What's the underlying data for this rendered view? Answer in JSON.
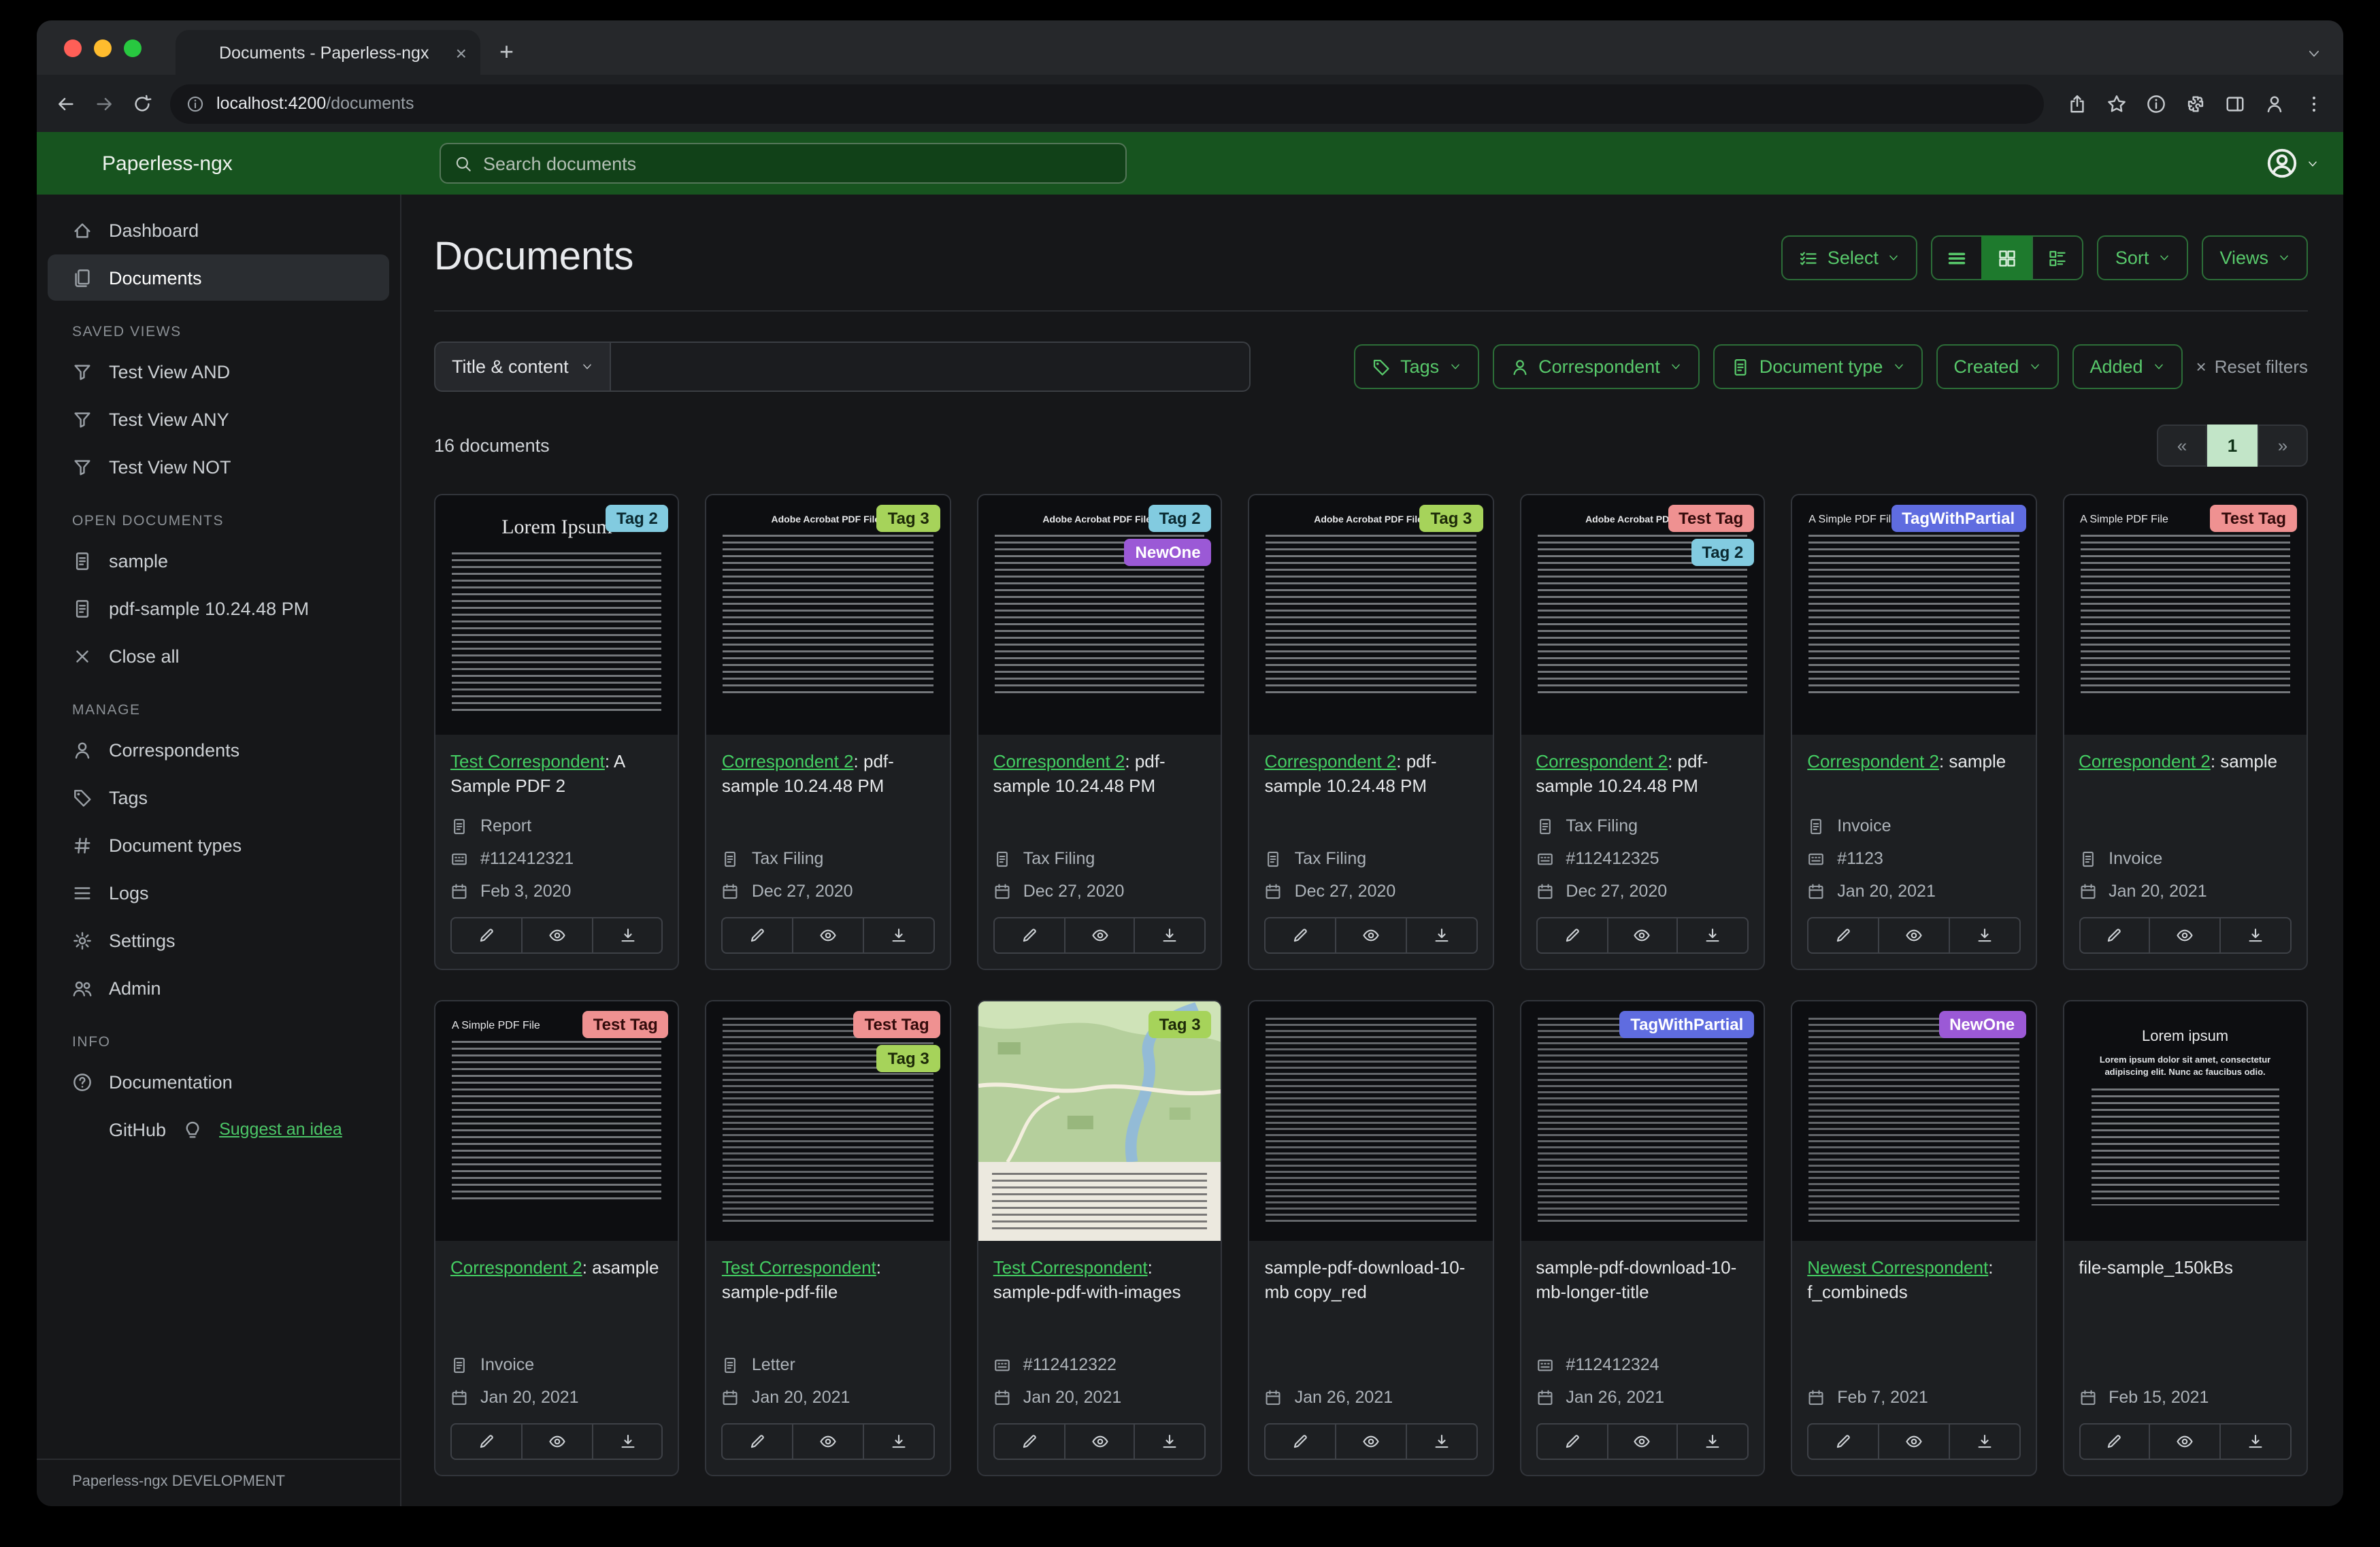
{
  "browser": {
    "tab_title": "Documents - Paperless-ngx",
    "url_host": "localhost:4200",
    "url_path": "/documents",
    "new_tab": "+",
    "tab_close": "×"
  },
  "header": {
    "brand": "Paperless-ngx",
    "search_placeholder": "Search documents"
  },
  "sidebar": {
    "primary": [
      {
        "label": "Dashboard",
        "icon": "house",
        "active": false
      },
      {
        "label": "Documents",
        "icon": "files",
        "active": true
      }
    ],
    "saved_views": {
      "heading": "SAVED VIEWS",
      "icon": "funnel",
      "items": [
        "Test View AND",
        "Test View ANY",
        "Test View NOT"
      ]
    },
    "open_documents": {
      "heading": "OPEN DOCUMENTS",
      "icon": "file",
      "items": [
        "sample",
        "pdf-sample 10.24.48 PM"
      ],
      "close_all": "Close all"
    },
    "manage": {
      "heading": "MANAGE",
      "items": [
        {
          "label": "Correspondents",
          "icon": "person"
        },
        {
          "label": "Tags",
          "icon": "tag"
        },
        {
          "label": "Document types",
          "icon": "hash"
        },
        {
          "label": "Logs",
          "icon": "listlines"
        },
        {
          "label": "Settings",
          "icon": "gear"
        },
        {
          "label": "Admin",
          "icon": "people"
        }
      ]
    },
    "info": {
      "heading": "INFO",
      "items": [
        {
          "label": "Documentation",
          "icon": "question"
        },
        {
          "label": "GitHub",
          "icon": "github",
          "extra_icon": "bulb",
          "extra": "Suggest an idea"
        }
      ]
    },
    "footer": "Paperless-ngx DEVELOPMENT"
  },
  "page": {
    "title": "Documents",
    "select": "Select",
    "sort": "Sort",
    "views": "Views"
  },
  "filters": {
    "field_dropdown": "Title & content",
    "buttons": [
      {
        "label": "Tags",
        "icon": "tag"
      },
      {
        "label": "Correspondent",
        "icon": "person"
      },
      {
        "label": "Document type",
        "icon": "file"
      },
      {
        "label": "Created",
        "icon": ""
      },
      {
        "label": "Added",
        "icon": ""
      }
    ],
    "reset_icon": "×",
    "reset": "Reset filters"
  },
  "results": {
    "count": "16 documents",
    "pager": {
      "prev": "«",
      "page": "1",
      "next": "»"
    }
  },
  "tag_colors": {
    "tag2": {
      "bg": "#82cbe0",
      "fg": "#0a2930"
    },
    "tag3": {
      "bg": "#a6d35a",
      "fg": "#1d2a08"
    },
    "newone": {
      "bg": "#9b59d6",
      "fg": "#ffffff"
    },
    "testtag": {
      "bg": "#ef9191",
      "fg": "#330b0b"
    },
    "tagwithpartial": {
      "bg": "#5f6ce0",
      "fg": "#ffffff"
    }
  },
  "documents": [
    {
      "tags": [
        {
          "label": "Tag 2",
          "color": "tag2"
        }
      ],
      "link": "Test Correspondent",
      "rest": ": A Sample PDF 2",
      "type": "Report",
      "asn": "#112412321",
      "date": "Feb 3, 2020",
      "thumb": {
        "kind": "lorem",
        "heading": "Lorem Ipsum"
      }
    },
    {
      "tags": [
        {
          "label": "Tag 3",
          "color": "tag3"
        }
      ],
      "link": "Correspondent 2",
      "rest": ": pdf-sample 10.24.48 PM",
      "type": "Tax Filing",
      "date": "Dec 27, 2020",
      "thumb": {
        "kind": "acrobat",
        "heading": "Adobe Acrobat PDF Files"
      }
    },
    {
      "tags": [
        {
          "label": "Tag 2",
          "color": "tag2"
        },
        {
          "label": "NewOne",
          "color": "newone"
        }
      ],
      "link": "Correspondent 2",
      "rest": ": pdf-sample 10.24.48 PM",
      "type": "Tax Filing",
      "date": "Dec 27, 2020",
      "thumb": {
        "kind": "acrobat",
        "heading": "Adobe Acrobat PDF Files"
      }
    },
    {
      "tags": [
        {
          "label": "Tag 3",
          "color": "tag3"
        }
      ],
      "link": "Correspondent 2",
      "rest": ": pdf-sample 10.24.48 PM",
      "type": "Tax Filing",
      "date": "Dec 27, 2020",
      "thumb": {
        "kind": "acrobat",
        "heading": "Adobe Acrobat PDF Files"
      }
    },
    {
      "tags": [
        {
          "label": "Test Tag",
          "color": "testtag"
        },
        {
          "label": "Tag 2",
          "color": "tag2"
        }
      ],
      "link": "Correspondent 2",
      "rest": ": pdf-sample 10.24.48 PM",
      "type": "Tax Filing",
      "asn": "#112412325",
      "date": "Dec 27, 2020",
      "thumb": {
        "kind": "acrobat",
        "heading": "Adobe Acrobat PDF Files"
      }
    },
    {
      "tags": [
        {
          "label": "TagWithPartial",
          "color": "tagwithpartial"
        }
      ],
      "link": "Correspondent 2",
      "rest": ": sample",
      "type": "Invoice",
      "asn": "#1123",
      "date": "Jan 20, 2021",
      "thumb": {
        "kind": "simple",
        "heading": "A Simple PDF File"
      }
    },
    {
      "tags": [
        {
          "label": "Test Tag",
          "color": "testtag"
        }
      ],
      "link": "Correspondent 2",
      "rest": ": sample",
      "type": "Invoice",
      "date": "Jan 20, 2021",
      "thumb": {
        "kind": "simple",
        "heading": "A Simple PDF File"
      }
    },
    {
      "tags": [
        {
          "label": "Test Tag",
          "color": "testtag"
        }
      ],
      "link": "Correspondent 2",
      "rest": ": asample",
      "type": "Invoice",
      "date": "Jan 20, 2021",
      "thumb": {
        "kind": "simple",
        "heading": "A Simple PDF File"
      }
    },
    {
      "tags": [
        {
          "label": "Test Tag",
          "color": "testtag"
        },
        {
          "label": "Tag 3",
          "color": "tag3"
        }
      ],
      "link": "Test Correspondent",
      "rest": ": sample-pdf-file",
      "type": "Letter",
      "date": "Jan 20, 2021",
      "thumb": {
        "kind": "text"
      }
    },
    {
      "tags": [
        {
          "label": "Tag 3",
          "color": "tag3"
        }
      ],
      "link": "Test Correspondent",
      "rest": ": sample-pdf-with-images",
      "asn": "#112412322",
      "date": "Jan 20, 2021",
      "thumb": {
        "kind": "map"
      }
    },
    {
      "tags": [],
      "title": "sample-pdf-download-10-mb copy_red",
      "date": "Jan 26, 2021",
      "thumb": {
        "kind": "text"
      }
    },
    {
      "tags": [
        {
          "label": "TagWithPartial",
          "color": "tagwithpartial"
        }
      ],
      "title": "sample-pdf-download-10-mb-longer-title",
      "asn": "#112412324",
      "date": "Jan 26, 2021",
      "thumb": {
        "kind": "text"
      }
    },
    {
      "tags": [
        {
          "label": "NewOne",
          "color": "newone"
        }
      ],
      "link": "Newest Correspondent",
      "rest": ": f_combineds",
      "date": "Feb 7, 2021",
      "thumb": {
        "kind": "text"
      }
    },
    {
      "tags": [],
      "title": "file-sample_150kBs",
      "date": "Feb 15, 2021",
      "thumb": {
        "kind": "lorem-center",
        "heading": "Lorem ipsum",
        "subheading": "Lorem ipsum dolor sit amet, consectetur adipiscing elit. Nunc ac faucibus odio."
      }
    }
  ]
}
